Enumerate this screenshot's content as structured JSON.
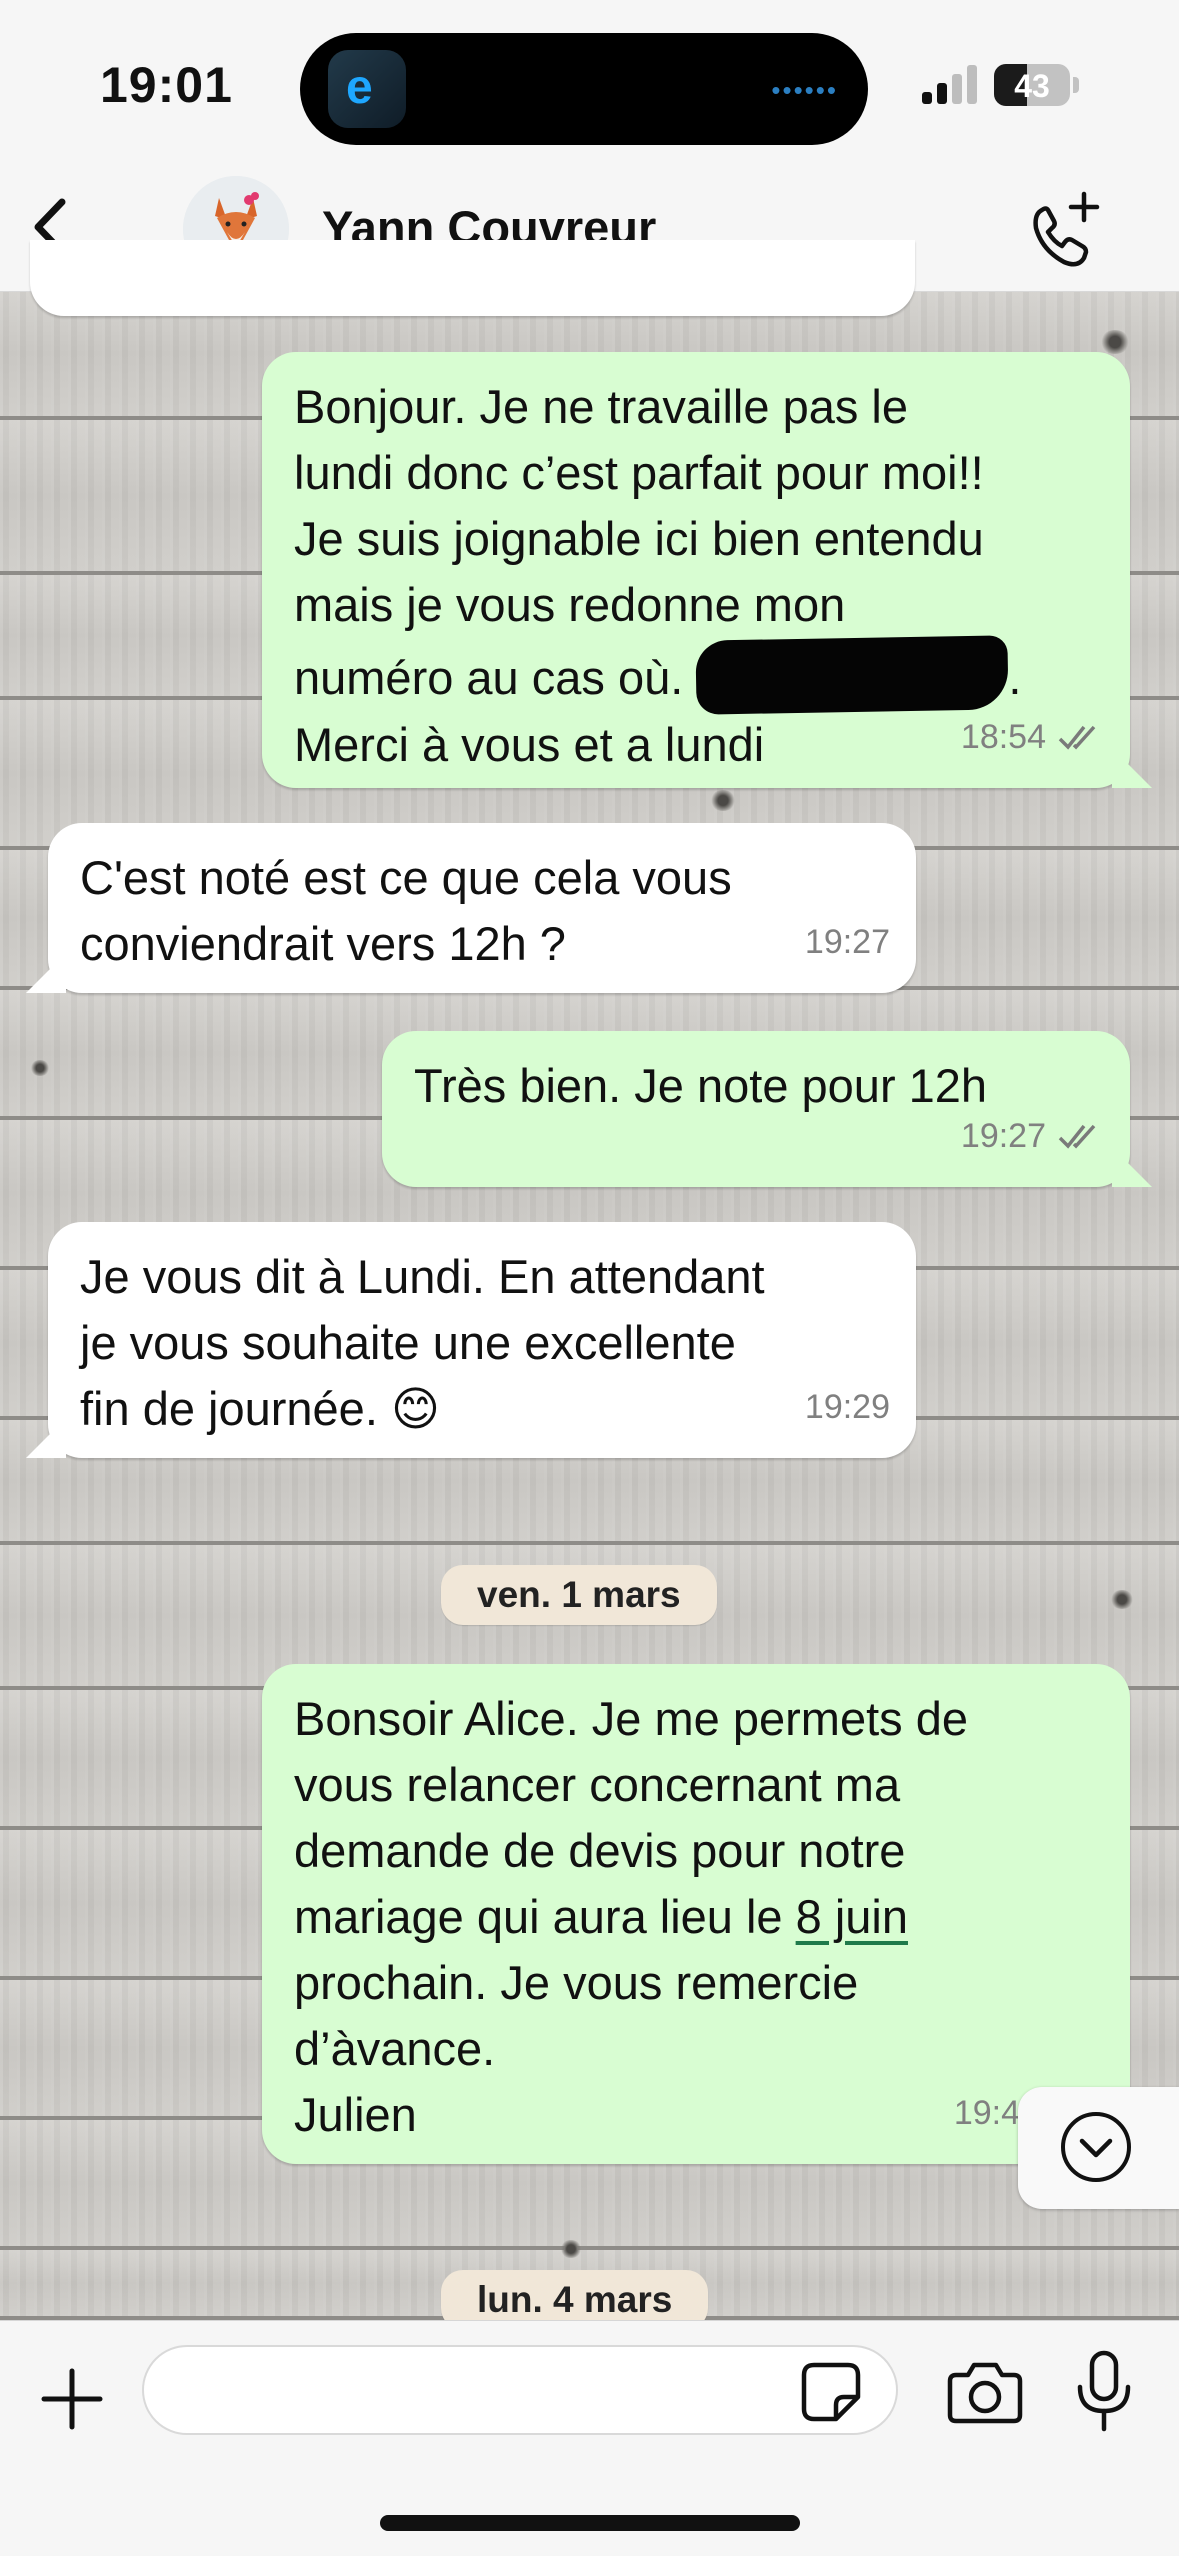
{
  "status_bar": {
    "time": "19:01",
    "battery_level": "43",
    "battery_fraction": 0.43,
    "signal_bars_active": 2,
    "signal_bars_total": 4,
    "island_app_letter": "e"
  },
  "header": {
    "contact_name": "Yann Couvreur",
    "back_icon": "chevron-left-icon",
    "call_icon": "add-call-icon"
  },
  "messages": [
    {
      "direction": "out",
      "text_before": "Bonjour. Je ne travaille pas le\nlundi donc c’est parfait pour moi!!\nJe suis joignable ici bien entendu\nmais je vous redonne mon\nnuméro au cas où. ",
      "text_after": ".\nMerci à vous et a lundi",
      "time": "18:54",
      "status": "read"
    },
    {
      "direction": "in",
      "text": "C'est noté est ce que cela vous\nconviendrait vers 12h ?",
      "time": "19:27"
    },
    {
      "direction": "out",
      "text": "Très bien. Je note pour 12h",
      "time": "19:27",
      "status": "read"
    },
    {
      "direction": "in",
      "text": "Je vous dit à Lundi. En attendant\nje vous souhaite une excellente\nfin de journée. 😊",
      "time": "19:29"
    },
    {
      "direction": "out",
      "text_before": "Bonsoir Alice. Je me permets de\nvous relancer concernant ma\ndemande de devis pour notre\nmariage qui aura lieu le ",
      "link": "8 juin",
      "text_after": "\nprochain. Je vous remercie\nd’àvance.\nJulien",
      "time": "19:4"
    }
  ],
  "date_separators": [
    "ven. 1 mars",
    "lun. 4 mars"
  ],
  "composer": {
    "placeholder": "",
    "value": ""
  },
  "colors": {
    "outgoing_bubble": "#d8fdd2",
    "incoming_bubble": "#ffffff",
    "date_chip": "#f1e7d8",
    "header_bg": "#f6f6f6"
  }
}
